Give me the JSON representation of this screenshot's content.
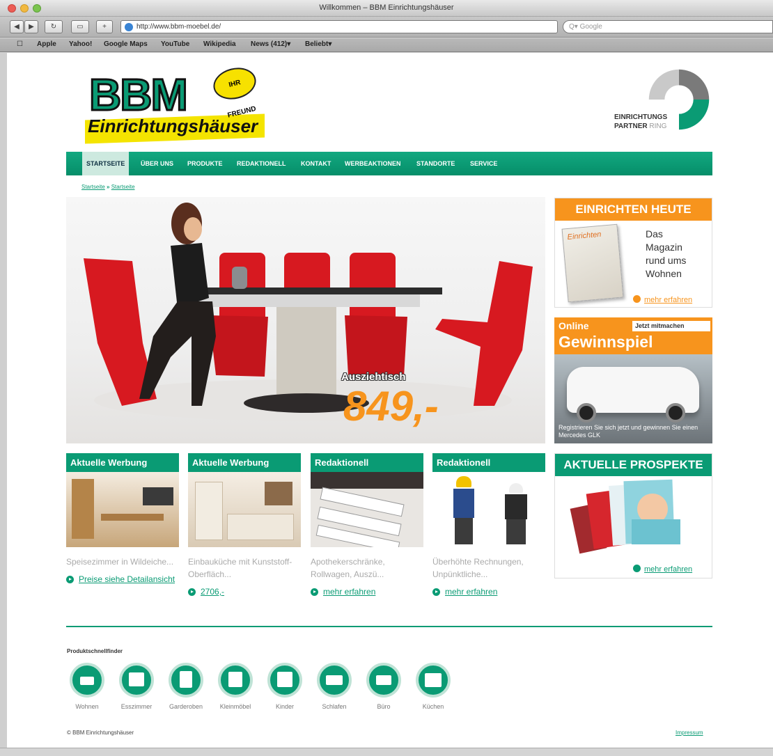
{
  "window": {
    "title": "Willkommen – BBM Einrichtungshäuser"
  },
  "toolbar": {
    "url": "http://www.bbm-moebel.de/",
    "search_placeholder": "Q▾ Google"
  },
  "bookmarks": [
    "Apple",
    "Yahoo!",
    "Google Maps",
    "YouTube",
    "Wikipedia",
    "News (412)▾",
    "Beliebt▾"
  ],
  "header": {
    "logo_main": "BBM",
    "logo_badge": "IHR FREUND",
    "logo_sub": "Einrichtungshäuser",
    "partner_line1": "EINRICHTUNGS",
    "partner_line2": "PARTNER",
    "partner_ring": "RING"
  },
  "nav": {
    "items": [
      "STARTSEITE",
      "ÜBER UNS",
      "PRODUKTE",
      "REDAKTIONELL",
      "KONTAKT",
      "WERBEAKTIONEN",
      "STANDORTE",
      "SERVICE"
    ]
  },
  "breadcrumb": {
    "home": "Startseite",
    "sep": "»",
    "current": "Startseite"
  },
  "hero": {
    "label": "Ausziehtisch",
    "price": "849,-"
  },
  "sidebar": {
    "einrichten": {
      "title": "EINRICHTEN HEUTE",
      "magazine_title": "Einrichten",
      "text": "Das\nMagazin\nrund ums\nWohnen",
      "link": "mehr erfahren"
    },
    "gewinnspiel": {
      "online": "Online",
      "badge": "Jetzt mitmachen",
      "title": "Gewinnspiel",
      "caption": "Registrieren Sie sich jetzt und gewinnen Sie einen Mercedes GLK"
    },
    "prospekte": {
      "title": "AKTUELLE PROSPEKTE",
      "link": "mehr erfahren"
    }
  },
  "teasers": [
    {
      "head": "Aktuelle Werbung",
      "desc": "Speisezimmer in Wildeiche...",
      "link": "Preise siehe Detailansicht"
    },
    {
      "head": "Aktuelle Werbung",
      "desc": "Einbauküche mit Kunststoff-Oberfläch...",
      "link": "2706,-"
    },
    {
      "head": "Redaktionell",
      "desc": "Apothekerschränke, Rollwagen, Auszü...",
      "link": "mehr erfahren"
    },
    {
      "head": "Redaktionell",
      "desc": "Überhöhte Rechnungen, Unpünktliche...",
      "link": "mehr erfahren"
    }
  ],
  "product_finder": {
    "title": "Produktschnellfinder",
    "items": [
      "Wohnen",
      "Esszimmer",
      "Garderoben",
      "Kleinmöbel",
      "Kinder",
      "Schlafen",
      "Büro",
      "Küchen"
    ]
  },
  "footer": {
    "copyright": "© BBM Einrichtungshäuser",
    "impressum": "Impressum"
  },
  "colors": {
    "green": "#0a9b74",
    "orange": "#f7941d",
    "yellow": "#f4e400"
  }
}
